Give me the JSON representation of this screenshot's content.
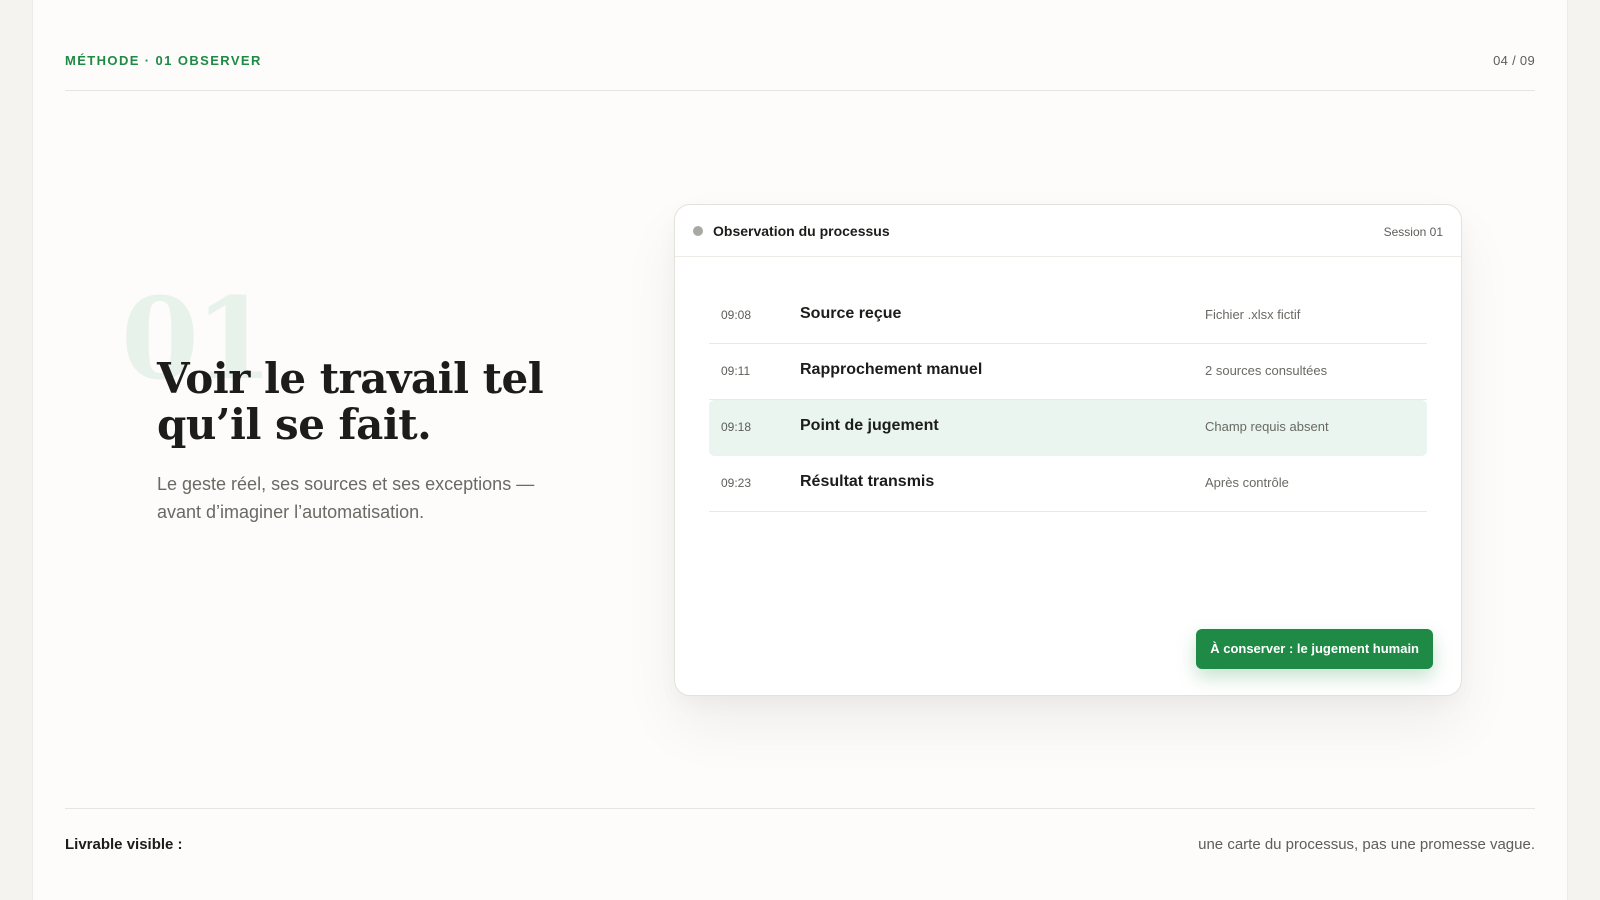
{
  "header": {
    "eyebrow": "MÉTHODE · 01 OBSERVER",
    "pager": "04 / 09"
  },
  "hero": {
    "number": "01",
    "title": "Voir le travail tel qu’il se fait.",
    "subtitle": "Le geste réel, ses sources et ses exceptions — avant d’imaginer l’automatisation."
  },
  "card": {
    "title": "Observation du processus",
    "session": "Session 01",
    "rows": [
      {
        "time": "09:08",
        "label": "Source reçue",
        "note": "Fichier .xlsx fictif"
      },
      {
        "time": "09:11",
        "label": "Rapprochement manuel",
        "note": "2 sources consultées"
      },
      {
        "time": "09:18",
        "label": "Point de jugement",
        "note": "Champ requis absent"
      },
      {
        "time": "09:23",
        "label": "Résultat transmis",
        "note": "Après contrôle"
      }
    ],
    "button_label": "À conserver : le jugement humain"
  },
  "footer": {
    "left": "Livrable visible :",
    "right": "une carte du processus, pas une promesse vague."
  },
  "colors": {
    "accent": "#1e8a45",
    "highlight_row": "#e9f5ee",
    "background": "#fdfcfa"
  }
}
